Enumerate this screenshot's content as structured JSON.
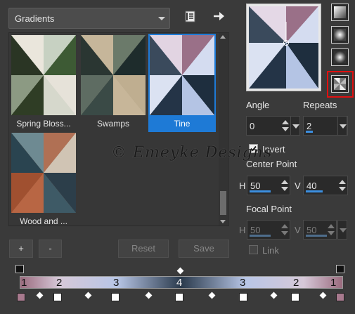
{
  "category_dropdown": {
    "value": "Gradients"
  },
  "gallery": {
    "items": [
      {
        "label": "Spring Bloss..."
      },
      {
        "label": "Swamps"
      },
      {
        "label": "Tine",
        "selected": true
      },
      {
        "label": "Wood and ..."
      }
    ]
  },
  "buttons": {
    "add": "+",
    "remove": "-",
    "reset": "Reset",
    "save": "Save"
  },
  "style_panel": {
    "angle": {
      "label": "Angle",
      "value": "0"
    },
    "repeats": {
      "label": "Repeats",
      "value": "2"
    },
    "invert": {
      "label": "Invert",
      "checked": true
    },
    "center_point": {
      "label": "Center Point",
      "h_label": "H",
      "h_value": "50",
      "v_label": "V",
      "v_value": "40"
    },
    "focal_point": {
      "label": "Focal Point",
      "h_label": "H",
      "h_value": "50",
      "v_label": "V",
      "v_value": "50"
    },
    "link": {
      "label": "Link",
      "checked": false
    }
  },
  "gradient_editor": {
    "stop_numbers": [
      "1",
      "2",
      "3",
      "4",
      "3",
      "2",
      "1"
    ]
  },
  "watermark": "© Emeyke Designs",
  "colors": {
    "accent": "#1e7ad6",
    "highlight": "#e01010",
    "background": "#3a3a3a"
  }
}
